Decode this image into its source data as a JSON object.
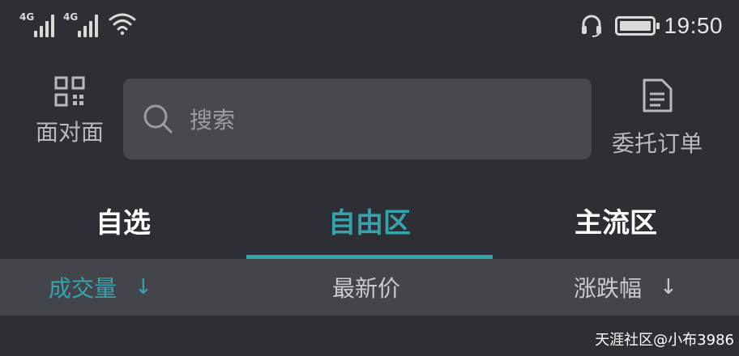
{
  "status_bar": {
    "sim1_label": "4G",
    "sim2_label": "4G",
    "time": "19:50",
    "icons": [
      "signal-icon",
      "signal-icon",
      "wifi-icon",
      "headset-icon",
      "battery-icon"
    ]
  },
  "header": {
    "face_to_face_label": "面对面",
    "search_placeholder": "搜索",
    "orders_label": "委托订单"
  },
  "tabs": [
    {
      "label": "自选",
      "active": false
    },
    {
      "label": "自由区",
      "active": true
    },
    {
      "label": "主流区",
      "active": false
    }
  ],
  "sort_bar": {
    "volume_label": "成交量",
    "volume_arrow": "↓",
    "price_label": "最新价",
    "change_label": "涨跌幅",
    "change_arrow": "↓"
  },
  "colors": {
    "background": "#2e2f35",
    "accent": "#36a3ad",
    "search_bg": "#48484e",
    "sort_bar_bg": "#44454b"
  },
  "watermark": "天涯社区@小布3986"
}
